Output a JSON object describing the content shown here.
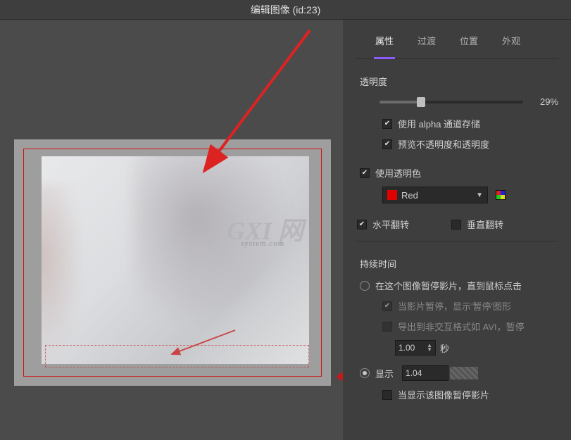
{
  "title": "编辑图像 (id:23)",
  "watermark": {
    "main": "GXI 网",
    "sub": "system.com"
  },
  "tabs": {
    "t0": "属性",
    "t1": "过渡",
    "t2": "位置",
    "t3": "外观"
  },
  "transparency": {
    "title": "透明度",
    "value": "29%",
    "alpha_label": "使用 alpha 通道存储",
    "preview_label": "预览不透明度和透明度"
  },
  "transcolor": {
    "label": "使用透明色",
    "color_name": "Red"
  },
  "flip": {
    "h": "水平翻转",
    "v": "垂直翻转"
  },
  "duration": {
    "title": "持续时间",
    "pause_radio": "在这个图像暂停影片，直到鼠标点击",
    "pause_shape": "当影片暂停，显示'暂停'图形",
    "export_pause": "导出到非交互格式如 AVI，暂停",
    "seconds_value": "1.00",
    "seconds_unit": "秒",
    "show_radio": "显示",
    "show_value": "1.04",
    "show_pause": "当显示该图像暂停影片"
  }
}
